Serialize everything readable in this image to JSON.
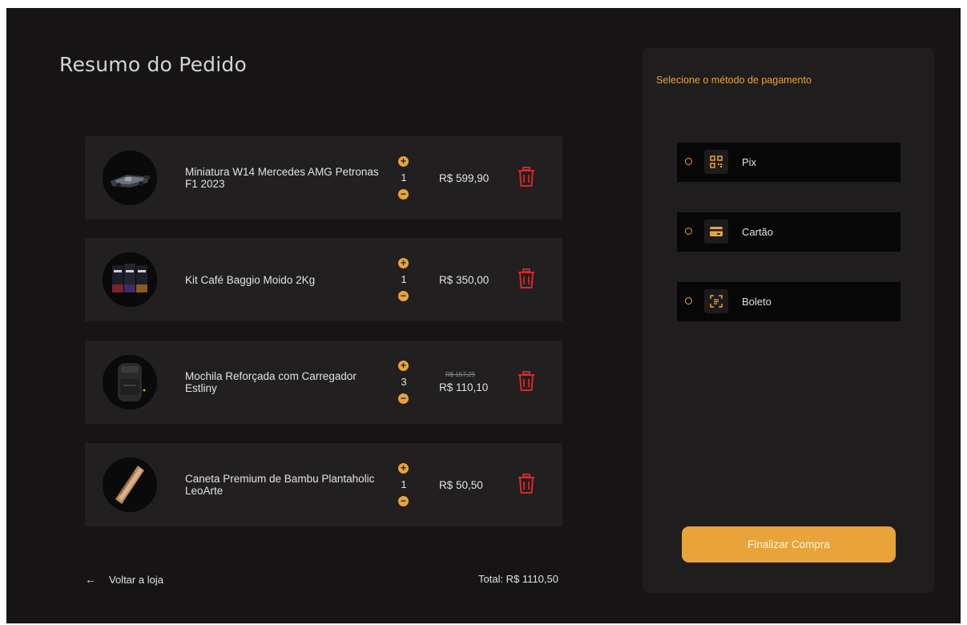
{
  "page": {
    "title": "Resumo do Pedido"
  },
  "cart": {
    "items": [
      {
        "name": "Miniatura W14 Mercedes AMG Petronas F1 2023",
        "quantity": "1",
        "price": "R$ 599,90",
        "old_price": ""
      },
      {
        "name": "Kit Café Baggio Moido 2Kg",
        "quantity": "1",
        "price": "R$ 350,00",
        "old_price": ""
      },
      {
        "name": "Mochila Reforçada com Carregador Estliny",
        "quantity": "3",
        "price": "R$ 110,10",
        "old_price": "R$ 157,29"
      },
      {
        "name": "Caneta Premium de Bambu Plantaholic LeoArte",
        "quantity": "1",
        "price": "R$ 50,50",
        "old_price": ""
      }
    ],
    "plus_symbol": "+",
    "minus_symbol": "−",
    "back_arrow": "←",
    "back_label": "Voltar a loja",
    "total": "Total: R$ 1110,50"
  },
  "payment": {
    "title": "Selecione o método de pagamento",
    "methods": [
      {
        "label": "Pix",
        "icon": "pix-qr-icon"
      },
      {
        "label": "Cartão",
        "icon": "credit-card-icon"
      },
      {
        "label": "Boleto",
        "icon": "barcode-scan-icon"
      }
    ],
    "submit_label": "Finalizar Compra"
  },
  "colors": {
    "accent": "#e8a33a",
    "trash": "#d42828",
    "background": "#161414",
    "card": "#211f1f"
  }
}
